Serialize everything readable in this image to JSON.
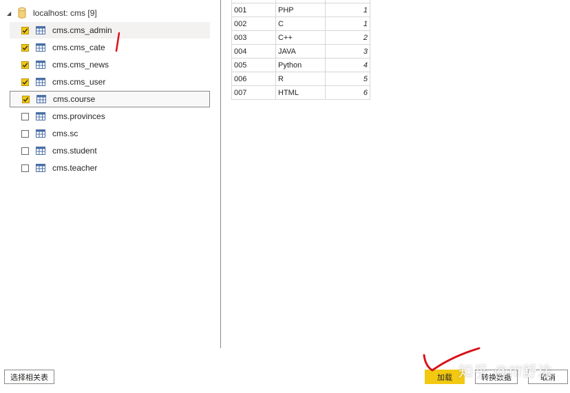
{
  "navigator": {
    "root": {
      "label": "localhost: cms [9]",
      "expanded": true
    },
    "items": [
      {
        "label": "cms.cms_admin",
        "checked": true,
        "state": "hovered"
      },
      {
        "label": "cms.cms_cate",
        "checked": true,
        "state": ""
      },
      {
        "label": "cms.cms_news",
        "checked": true,
        "state": ""
      },
      {
        "label": "cms.cms_user",
        "checked": true,
        "state": ""
      },
      {
        "label": "cms.course",
        "checked": true,
        "state": "selected"
      },
      {
        "label": "cms.provinces",
        "checked": false,
        "state": ""
      },
      {
        "label": "cms.sc",
        "checked": false,
        "state": ""
      },
      {
        "label": "cms.student",
        "checked": false,
        "state": ""
      },
      {
        "label": "cms.teacher",
        "checked": false,
        "state": ""
      }
    ]
  },
  "preview": {
    "rows": [
      [
        "001",
        "PHP",
        "1"
      ],
      [
        "002",
        "C",
        "1"
      ],
      [
        "003",
        "C++",
        "2"
      ],
      [
        "004",
        "JAVA",
        "3"
      ],
      [
        "005",
        "Python",
        "4"
      ],
      [
        "006",
        "R",
        "5"
      ],
      [
        "007",
        "HTML",
        "6"
      ]
    ]
  },
  "footer": {
    "select_related_label": "选择相关表",
    "load_label": "加载",
    "transform_label": "转换数据",
    "cancel_label": "取消"
  },
  "watermark": {
    "text": "知乎 @fff舒涂"
  },
  "colors": {
    "accent": "#f2c811",
    "annotation_red": "#d9121b",
    "divider": "#8a8886"
  },
  "icons": {
    "expand": "triangle-down-icon",
    "database": "database-icon",
    "table": "table-icon",
    "checkbox": "checkmark-icon"
  }
}
